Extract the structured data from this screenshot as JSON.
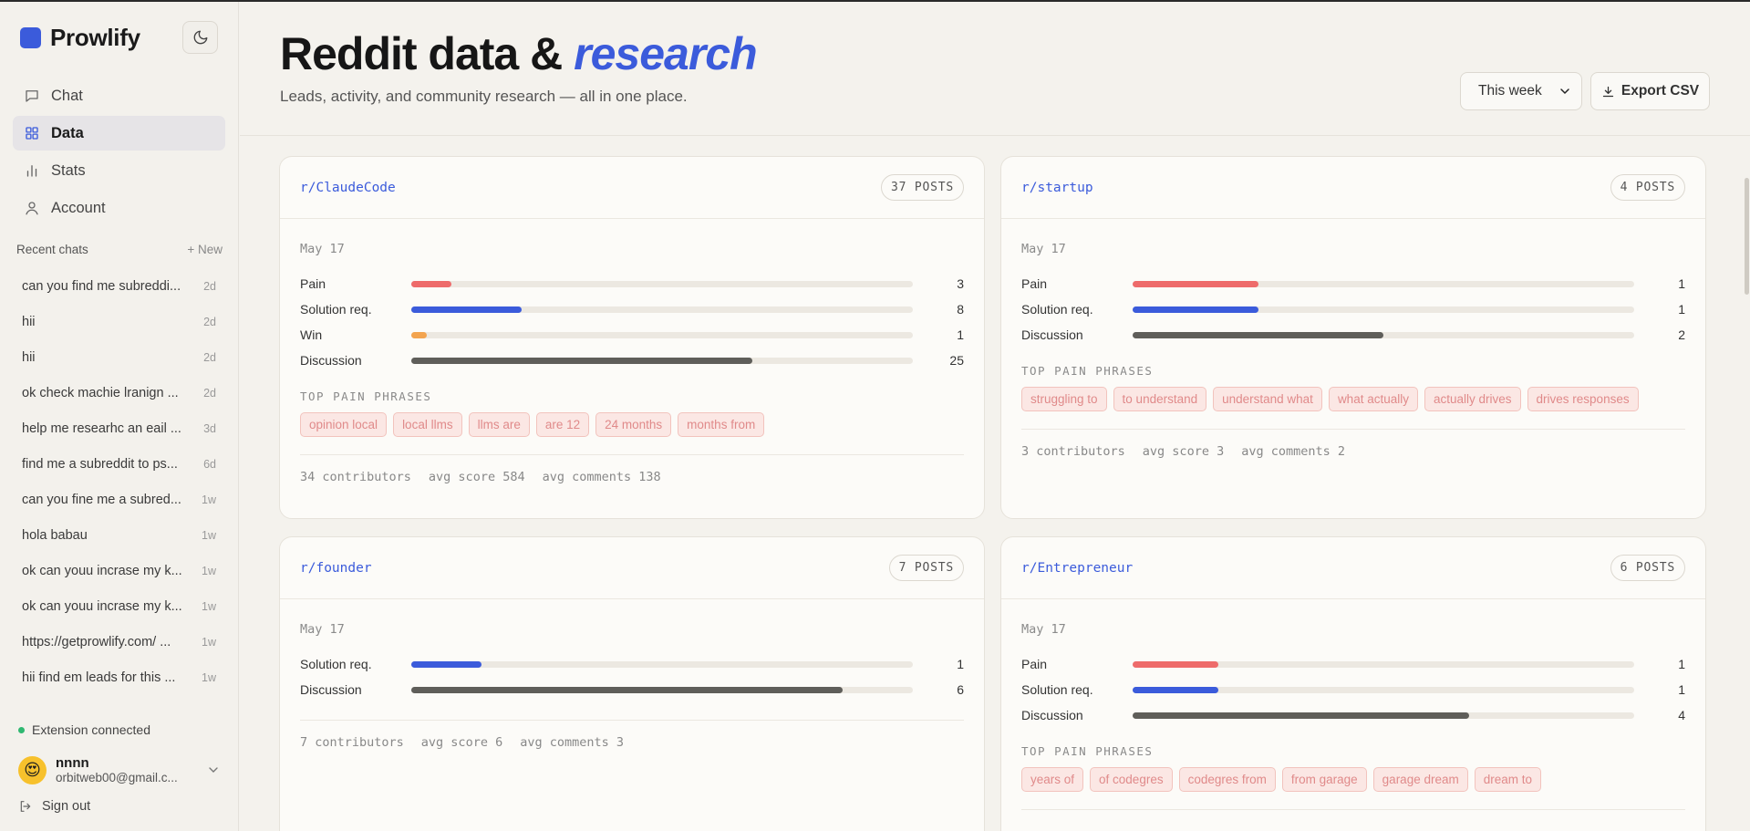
{
  "app": {
    "name": "Prowlify"
  },
  "nav": [
    {
      "label": "Chat",
      "icon": "chat-icon",
      "active": false
    },
    {
      "label": "Data",
      "icon": "grid-icon",
      "active": true
    },
    {
      "label": "Stats",
      "icon": "bar-chart-icon",
      "active": false
    },
    {
      "label": "Account",
      "icon": "user-icon",
      "active": false
    }
  ],
  "recent": {
    "title": "Recent chats",
    "new_label": "+ New",
    "items": [
      {
        "title": "can you find me subreddi...",
        "age": "2d"
      },
      {
        "title": "hii",
        "age": "2d"
      },
      {
        "title": "hii",
        "age": "2d"
      },
      {
        "title": "ok check machie lranign ...",
        "age": "2d"
      },
      {
        "title": "help me researhc an eail ...",
        "age": "3d"
      },
      {
        "title": "find me a subreddit to ps...",
        "age": "6d"
      },
      {
        "title": "can you fine me a subred...",
        "age": "1w"
      },
      {
        "title": "hola babau",
        "age": "1w"
      },
      {
        "title": "ok can youu incrase my k...",
        "age": "1w"
      },
      {
        "title": "ok can youu incrase my k...",
        "age": "1w"
      },
      {
        "title": "https://getprowlify.com/ ...",
        "age": "1w"
      },
      {
        "title": "hii find em leads for this ...",
        "age": "1w"
      }
    ]
  },
  "extension": {
    "status": "Extension connected",
    "color": "#2fb871"
  },
  "user": {
    "name": "nnnn",
    "email": "orbitweb00@gmail.c...",
    "avatar_emoji": "😍"
  },
  "signout_label": "Sign out",
  "header": {
    "title_prefix": "Reddit data & ",
    "title_accent": "research",
    "subtitle": "Leads, activity, and community research — all in one place.",
    "range": "This week",
    "export_label": "Export CSV"
  },
  "colors": {
    "accent": "#3b5bdb",
    "pain": "#ee6b6b",
    "solution": "#3b5bdb",
    "win": "#f3a44f",
    "discussion": "#5f5e5a"
  },
  "cards": [
    {
      "subreddit": "r/ClaudeCode",
      "posts": "37 POSTS",
      "date": "May 17",
      "metrics": [
        {
          "label": "Pain",
          "value": 3,
          "fill": 0.08,
          "kind": "pain"
        },
        {
          "label": "Solution req.",
          "value": 8,
          "fill": 0.22,
          "kind": "solution"
        },
        {
          "label": "Win",
          "value": 1,
          "fill": 0.03,
          "kind": "win"
        },
        {
          "label": "Discussion",
          "value": 25,
          "fill": 0.68,
          "kind": "discussion"
        }
      ],
      "phrases_title": "TOP PAIN PHRASES",
      "phrases": [
        "opinion local",
        "local llms",
        "llms are",
        "are 12",
        "24 months",
        "months from"
      ],
      "contributors": "34 contributors",
      "avg_score": "avg score 584",
      "avg_comments": "avg comments 138"
    },
    {
      "subreddit": "r/startup",
      "posts": "4 POSTS",
      "date": "May 17",
      "metrics": [
        {
          "label": "Pain",
          "value": 1,
          "fill": 0.25,
          "kind": "pain"
        },
        {
          "label": "Solution req.",
          "value": 1,
          "fill": 0.25,
          "kind": "solution"
        },
        {
          "label": "Discussion",
          "value": 2,
          "fill": 0.5,
          "kind": "discussion"
        }
      ],
      "phrases_title": "TOP PAIN PHRASES",
      "phrases": [
        "struggling to",
        "to understand",
        "understand what",
        "what actually",
        "actually drives",
        "drives responses"
      ],
      "contributors": "3 contributors",
      "avg_score": "avg score 3",
      "avg_comments": "avg comments 2"
    },
    {
      "subreddit": "r/founder",
      "posts": "7 POSTS",
      "date": "May 17",
      "metrics": [
        {
          "label": "Solution req.",
          "value": 1,
          "fill": 0.14,
          "kind": "solution"
        },
        {
          "label": "Discussion",
          "value": 6,
          "fill": 0.86,
          "kind": "discussion"
        }
      ],
      "phrases_title": "",
      "phrases": [],
      "contributors": "7 contributors",
      "avg_score": "avg score 6",
      "avg_comments": "avg comments 3"
    },
    {
      "subreddit": "r/Entrepreneur",
      "posts": "6 POSTS",
      "date": "May 17",
      "metrics": [
        {
          "label": "Pain",
          "value": 1,
          "fill": 0.17,
          "kind": "pain"
        },
        {
          "label": "Solution req.",
          "value": 1,
          "fill": 0.17,
          "kind": "solution"
        },
        {
          "label": "Discussion",
          "value": 4,
          "fill": 0.67,
          "kind": "discussion"
        }
      ],
      "phrases_title": "TOP PAIN PHRASES",
      "phrases": [
        "years of",
        "of codegres",
        "codegres from",
        "from garage",
        "garage dream",
        "dream to"
      ],
      "contributors": "",
      "avg_score": "",
      "avg_comments": ""
    }
  ]
}
